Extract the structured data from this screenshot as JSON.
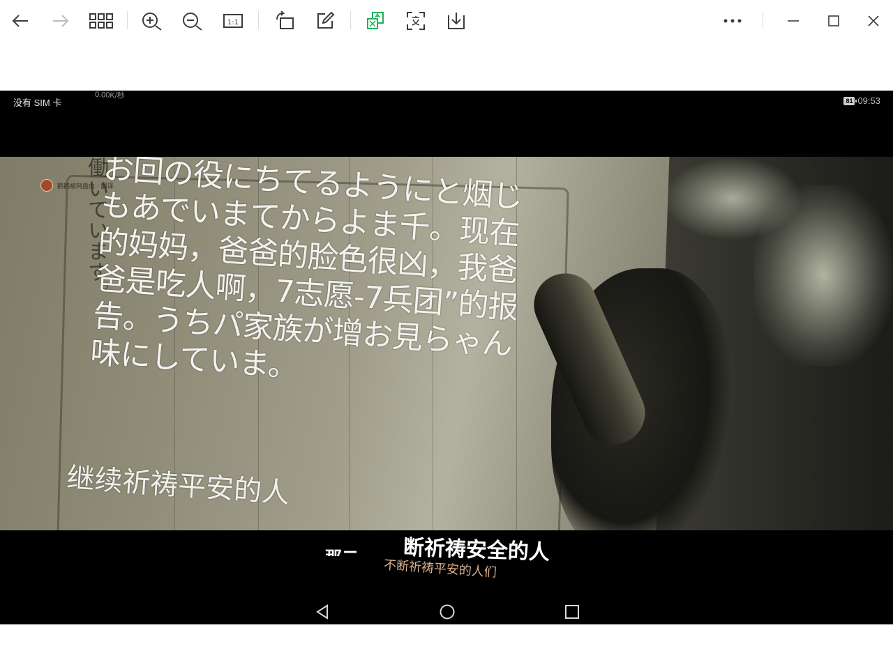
{
  "toolbar": {
    "buttons": [
      "back",
      "forward",
      "thumbnails",
      "zoom-in",
      "zoom-out",
      "actual-size",
      "rotate",
      "edit",
      "translate",
      "ocr-text",
      "download",
      "more",
      "minimize",
      "maximize",
      "close"
    ],
    "actual_size_label": "1:1"
  },
  "colors": {
    "toolbar_icon": "#3c3c3c",
    "toolbar_icon_disabled": "#bdbdbd",
    "translate_accent": "#1fb35a",
    "shot_background": "#000000"
  },
  "phone_status": {
    "carrier": "没有 SIM 卡",
    "speed": "0.00K/秒",
    "battery": "81",
    "time": "09:53"
  },
  "video": {
    "watermark": "鹳鹳被网盘内 · 翻译",
    "handwriting": "働いています。",
    "overlay_text": "お回の役にちてるようにと烟じもあでいまてからよま千。现在的妈妈，爸爸的脸色很凶，我爸爸是吃人啊，7志愿-7兵团”的报告。うちパ家族が增お見らゃん味にしていま。",
    "overlay_text_2": "继续祈祷平安的人",
    "subtitle_cut": "那二",
    "subtitle_main": "断祈祷安全的人",
    "subtitle_alt": "不断祈祷平安的人们"
  },
  "android_nav": [
    "back",
    "home",
    "recents"
  ]
}
